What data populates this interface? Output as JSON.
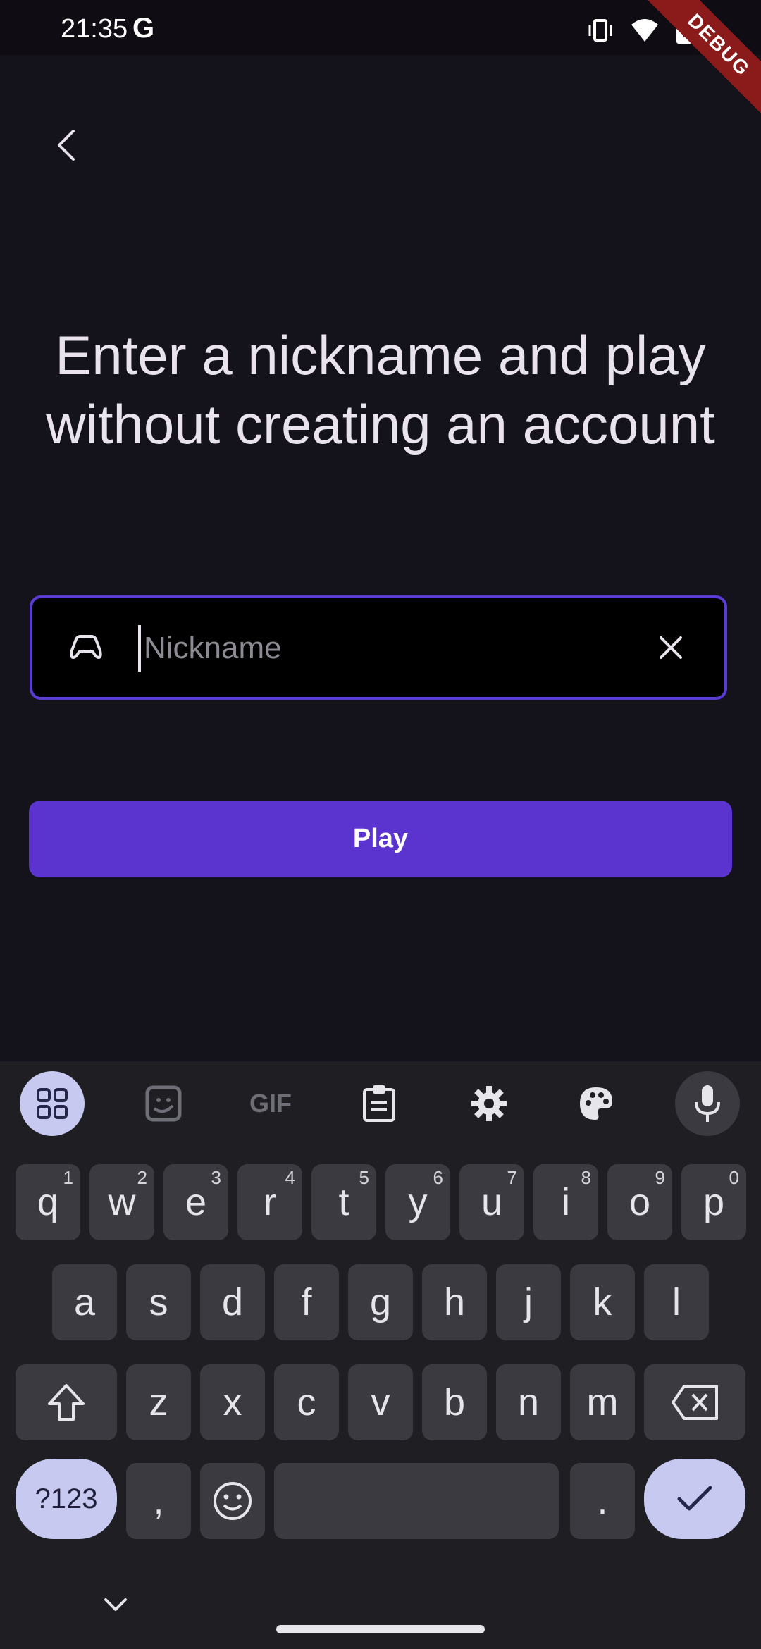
{
  "status_bar": {
    "time": "21:35",
    "g_logo": "G",
    "icons": [
      "vibrate-icon",
      "wifi-icon",
      "battery-charging-icon"
    ],
    "debug_label": "DEBUG"
  },
  "header": {
    "back_icon": "chevron-left-icon"
  },
  "main": {
    "headline": "Enter a nickname and play without creating an account",
    "nickname_field": {
      "icon": "gamepad-icon",
      "placeholder": "Nickname",
      "value": "",
      "clear_icon": "close-icon"
    },
    "play_label": "Play"
  },
  "keyboard": {
    "toolbar": [
      "apps-icon",
      "sticker-icon",
      "gif-icon",
      "clipboard-icon",
      "settings-icon",
      "palette-icon",
      "mic-icon"
    ],
    "gif_label": "GIF",
    "row1": [
      {
        "key": "q",
        "hint": "1"
      },
      {
        "key": "w",
        "hint": "2"
      },
      {
        "key": "e",
        "hint": "3"
      },
      {
        "key": "r",
        "hint": "4"
      },
      {
        "key": "t",
        "hint": "5"
      },
      {
        "key": "y",
        "hint": "6"
      },
      {
        "key": "u",
        "hint": "7"
      },
      {
        "key": "i",
        "hint": "8"
      },
      {
        "key": "o",
        "hint": "9"
      },
      {
        "key": "p",
        "hint": "0"
      }
    ],
    "row2": [
      "a",
      "s",
      "d",
      "f",
      "g",
      "h",
      "j",
      "k",
      "l"
    ],
    "row3": [
      "z",
      "x",
      "c",
      "v",
      "b",
      "n",
      "m"
    ],
    "symbols_label": "?123",
    "comma": ",",
    "period": ".",
    "colors": {
      "accent": "#5b33cf",
      "key": "#3a3a40",
      "keyboard_bg": "#1e1e23",
      "sym_key": "#c7c9f0"
    }
  }
}
